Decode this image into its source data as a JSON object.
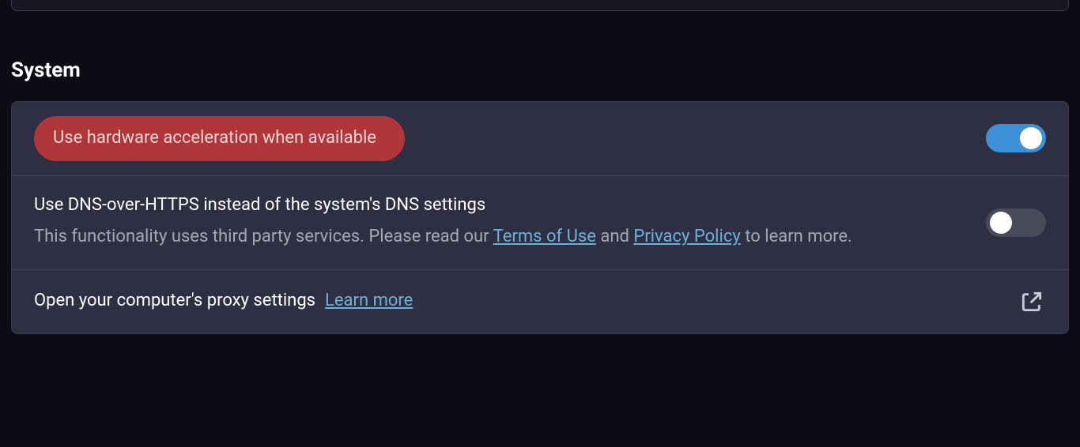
{
  "section": {
    "title": "System"
  },
  "rows": {
    "hw_accel": {
      "label": "Use hardware acceleration when available",
      "enabled": true
    },
    "dns_https": {
      "title": "Use DNS-over-HTTPS instead of the system's DNS settings",
      "desc_prefix": "This functionality uses third party services. Please read our ",
      "terms_link": "Terms of Use",
      "desc_mid": " and ",
      "privacy_link": "Privacy Policy",
      "desc_suffix": " to learn more.",
      "enabled": false
    },
    "proxy": {
      "title": "Open your computer's proxy settings",
      "learn_more": "Learn more"
    }
  }
}
